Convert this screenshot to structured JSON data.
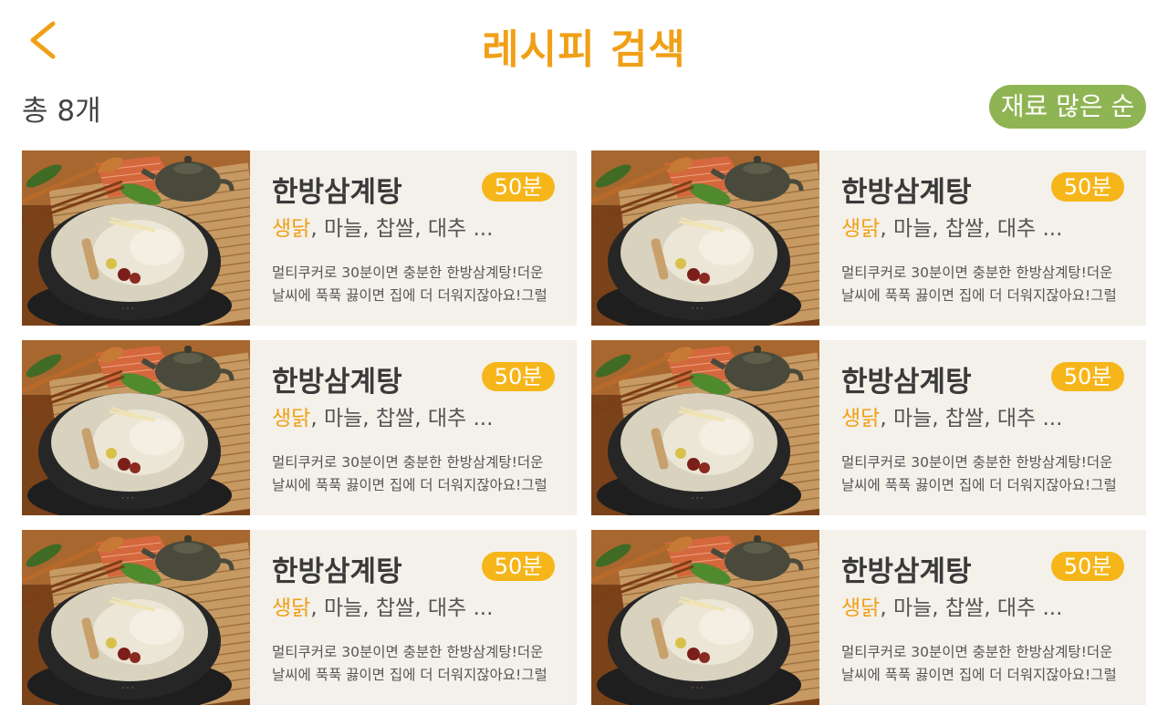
{
  "header": {
    "title": "레시피 검색",
    "back_icon": "chevron-left-icon"
  },
  "summary": {
    "count_label": "총 8개"
  },
  "sort": {
    "label": "재료 많은 순"
  },
  "colors": {
    "accent": "#f0a017",
    "badge": "#f6b61a",
    "sort_button": "#8fb453",
    "card_background": "#f4f0ea"
  },
  "recipes": [
    {
      "name": "한방삼계탕",
      "time": "50분",
      "main_ingredient": "생닭",
      "other_ingredients": ", 마늘, 찹쌀, 대추 ...",
      "description": "멀티쿠커로 30분이면 충분한 한방삼계탕!더운 날씨에 푹푹 끓이면 집에 더 더워지잖아요!그럴 때"
    },
    {
      "name": "한방삼계탕",
      "time": "50분",
      "main_ingredient": "생닭",
      "other_ingredients": ", 마늘, 찹쌀, 대추 ...",
      "description": "멀티쿠커로 30분이면 충분한 한방삼계탕!더운 날씨에 푹푹 끓이면 집에 더 더워지잖아요!그럴 때"
    },
    {
      "name": "한방삼계탕",
      "time": "50분",
      "main_ingredient": "생닭",
      "other_ingredients": ", 마늘, 찹쌀, 대추 ...",
      "description": "멀티쿠커로 30분이면 충분한 한방삼계탕!더운 날씨에 푹푹 끓이면 집에 더 더워지잖아요!그럴 때"
    },
    {
      "name": "한방삼계탕",
      "time": "50분",
      "main_ingredient": "생닭",
      "other_ingredients": ", 마늘, 찹쌀, 대추 ...",
      "description": "멀티쿠커로 30분이면 충분한 한방삼계탕!더운 날씨에 푹푹 끓이면 집에 더 더워지잖아요!그럴 때"
    },
    {
      "name": "한방삼계탕",
      "time": "50분",
      "main_ingredient": "생닭",
      "other_ingredients": ", 마늘, 찹쌀, 대추 ...",
      "description": "멀티쿠커로 30분이면 충분한 한방삼계탕!더운 날씨에 푹푹 끓이면 집에 더 더워지잖아요!그럴 때"
    },
    {
      "name": "한방삼계탕",
      "time": "50분",
      "main_ingredient": "생닭",
      "other_ingredients": ", 마늘, 찹쌀, 대추 ...",
      "description": "멀티쿠커로 30분이면 충분한 한방삼계탕!더운 날씨에 푹푹 끓이면 집에 더 더워지잖아요!그럴 때"
    }
  ]
}
